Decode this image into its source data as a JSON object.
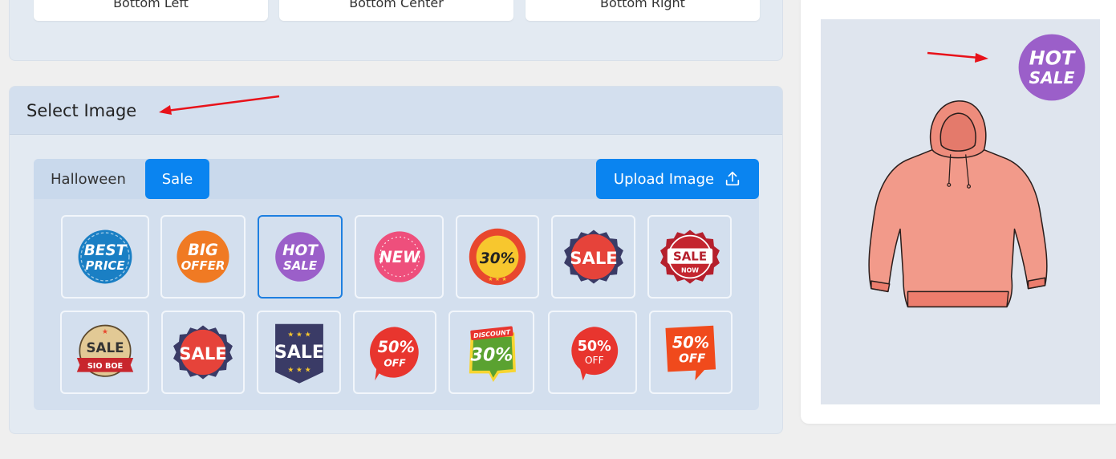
{
  "position_buttons": [
    {
      "label": "Bottom Left"
    },
    {
      "label": "Bottom Center"
    },
    {
      "label": "Bottom Right"
    }
  ],
  "select_image": {
    "title": "Select Image",
    "tabs": [
      {
        "label": "Halloween",
        "active": false
      },
      {
        "label": "Sale",
        "active": true
      }
    ],
    "upload_label": "Upload Image",
    "stickers": [
      {
        "name": "best-price",
        "lines": [
          "BEST",
          "PRICE"
        ],
        "color": "#1a7fc4",
        "selected": false
      },
      {
        "name": "big-offer",
        "lines": [
          "BIG",
          "OFFER"
        ],
        "color": "#f07a23",
        "selected": false
      },
      {
        "name": "hot-sale",
        "lines": [
          "HOT",
          "SALE"
        ],
        "color": "#9b5fc9",
        "selected": true
      },
      {
        "name": "new",
        "lines": [
          "NEW"
        ],
        "color": "#ee4f7c",
        "selected": false
      },
      {
        "name": "30-percent",
        "lines": [
          "30%"
        ],
        "color": "#e8472e",
        "selected": false
      },
      {
        "name": "sale-badge-red",
        "lines": [
          "SALE"
        ],
        "color": "#e6433a",
        "selected": false
      },
      {
        "name": "sale-now",
        "lines": [
          "SALE",
          "NOW"
        ],
        "color": "#b51f2c",
        "selected": false
      },
      {
        "name": "sale-ribbon",
        "lines": [
          "SALE",
          "SIO BOE"
        ],
        "color": "#e2c995",
        "selected": false
      },
      {
        "name": "sale-seal",
        "lines": [
          "SALE"
        ],
        "color": "#e6433a",
        "selected": false
      },
      {
        "name": "sale-shield",
        "lines": [
          "SALE"
        ],
        "color": "#3a3b66",
        "selected": false
      },
      {
        "name": "50-off-bubble",
        "lines": [
          "50%",
          "OFF"
        ],
        "color": "#e8352e",
        "selected": false
      },
      {
        "name": "discount-30",
        "lines": [
          "DISCOUNT",
          "30%"
        ],
        "color": "#5aa230",
        "selected": false
      },
      {
        "name": "50-off-round",
        "lines": [
          "50%",
          "OFF"
        ],
        "color": "#e8352e",
        "selected": false
      },
      {
        "name": "50-off-square",
        "lines": [
          "50%",
          "OFF"
        ],
        "color": "#f04a1c",
        "selected": false
      }
    ]
  },
  "preview": {
    "sticker_lines": [
      "HOT",
      "SALE"
    ],
    "sticker_color": "#9b5fc9",
    "product": "hoodie",
    "product_color": "#f29a8a"
  },
  "colors": {
    "accent": "#0a84f0",
    "annotation_arrow": "#e8121a"
  }
}
